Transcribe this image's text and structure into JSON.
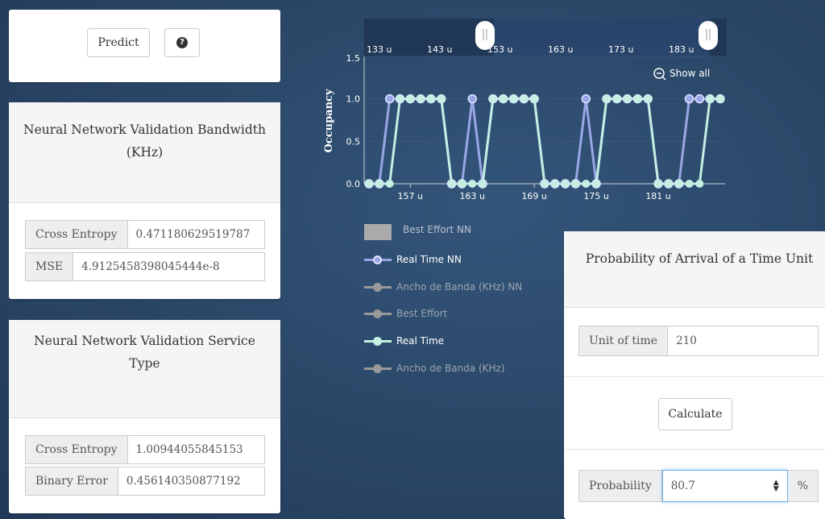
{
  "predict_panel": {
    "predict_label": "Predict",
    "help_icon": "question-circle-icon"
  },
  "bandwidth_panel": {
    "title": "Neural Network Validation Bandwidth (KHz)",
    "cross_entropy_label": "Cross Entropy",
    "cross_entropy_value": "0.471180629519787",
    "mse_label": "MSE",
    "mse_value": "4.9125458398045444e-8"
  },
  "service_panel": {
    "title": "Neural Network Validation Service Type",
    "cross_entropy_label": "Cross Entropy",
    "cross_entropy_value": "1.00944055845153",
    "binary_error_label": "Binary Error",
    "binary_error_value": "0.456140350877192"
  },
  "probability_panel": {
    "title": "Probability of Arrival of a Time Unit",
    "unit_label": "Unit of time",
    "unit_value": "210",
    "calculate_label": "Calculate",
    "probability_label": "Probability",
    "probability_value": "80.7",
    "percent_label": "%"
  },
  "chart": {
    "navigator_labels": [
      "133 u",
      "143 u",
      "153 u",
      "163 u",
      "173 u",
      "183 u"
    ],
    "show_all_label": "Show all"
  },
  "legend": [
    {
      "label": "Best Effort NN",
      "color": "#aaaaaa",
      "style": "box",
      "dim": false
    },
    {
      "label": "Real Time NN",
      "color": "#9aa6e6",
      "style": "line",
      "dim": false
    },
    {
      "label": "Ancho de Banda (KHz) NN",
      "color": "#999999",
      "style": "line",
      "dim": true
    },
    {
      "label": "Best Effort",
      "color": "#999999",
      "style": "line",
      "dim": true
    },
    {
      "label": "Real Time",
      "color": "#c4efe3",
      "style": "line",
      "dim": false
    },
    {
      "label": "Ancho de Banda (KHz)",
      "color": "#999999",
      "style": "line",
      "dim": true
    }
  ],
  "chart_data": {
    "type": "line",
    "ylabel": "Occupancy",
    "xlabel": "",
    "ylim": [
      0,
      1.5
    ],
    "y_ticks": [
      "0.0",
      "0.5",
      "1.0",
      "1.5"
    ],
    "x_ticks": [
      "157 u",
      "163 u",
      "169 u",
      "175 u",
      "181 u"
    ],
    "x": [
      153,
      154,
      155,
      156,
      157,
      158,
      159,
      160,
      161,
      162,
      163,
      164,
      165,
      166,
      167,
      168,
      169,
      170,
      171,
      172,
      173,
      174,
      175,
      176,
      177,
      178,
      179,
      180,
      181,
      182,
      183,
      184,
      185,
      186,
      187
    ],
    "series": [
      {
        "name": "Real Time NN",
        "color": "#9aa6e6",
        "values": [
          0,
          0,
          1,
          1,
          1,
          1,
          1,
          1,
          0,
          0,
          1,
          0,
          1,
          1,
          1,
          1,
          1,
          0,
          0,
          0,
          0,
          1,
          0,
          1,
          1,
          1,
          1,
          1,
          0,
          0,
          0,
          1,
          1,
          1,
          1
        ]
      },
      {
        "name": "Real Time",
        "color": "#c4efe3",
        "values": [
          0,
          0,
          0,
          1,
          1,
          1,
          1,
          1,
          0,
          0,
          0,
          0,
          1,
          1,
          1,
          1,
          1,
          0,
          0,
          0,
          0,
          0,
          0,
          1,
          1,
          1,
          1,
          1,
          0,
          0,
          0,
          0,
          0,
          1,
          1
        ]
      }
    ]
  }
}
